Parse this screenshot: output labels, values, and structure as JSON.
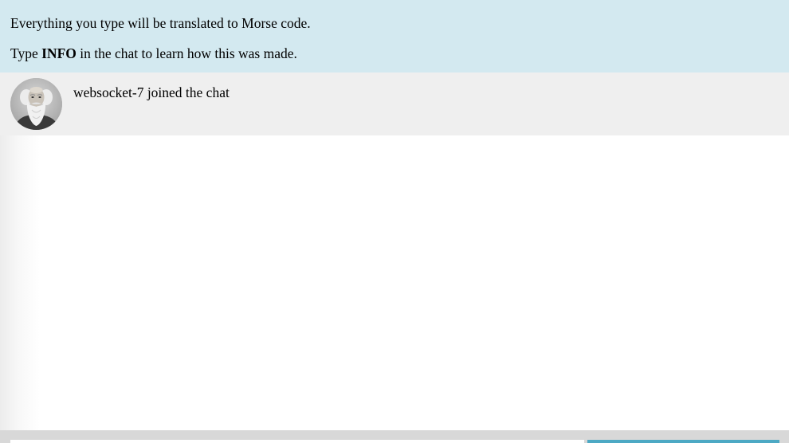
{
  "banner": {
    "line1": "Everything you type will be translated to Morse code.",
    "line2_prefix": "Type ",
    "line2_keyword": "INFO",
    "line2_suffix": " in the chat to learn how this was made."
  },
  "messages": [
    {
      "avatar": "samuel-morse-portrait",
      "text": "websocket-7 joined the chat"
    }
  ],
  "composer": {
    "input_value": "",
    "input_placeholder": "",
    "send_label": ""
  },
  "colors": {
    "banner_bg": "#d3e9f0",
    "message_bg": "#efefef",
    "input_bar_bg": "#d8d8d8",
    "send_button_bg": "#4da9c4"
  }
}
